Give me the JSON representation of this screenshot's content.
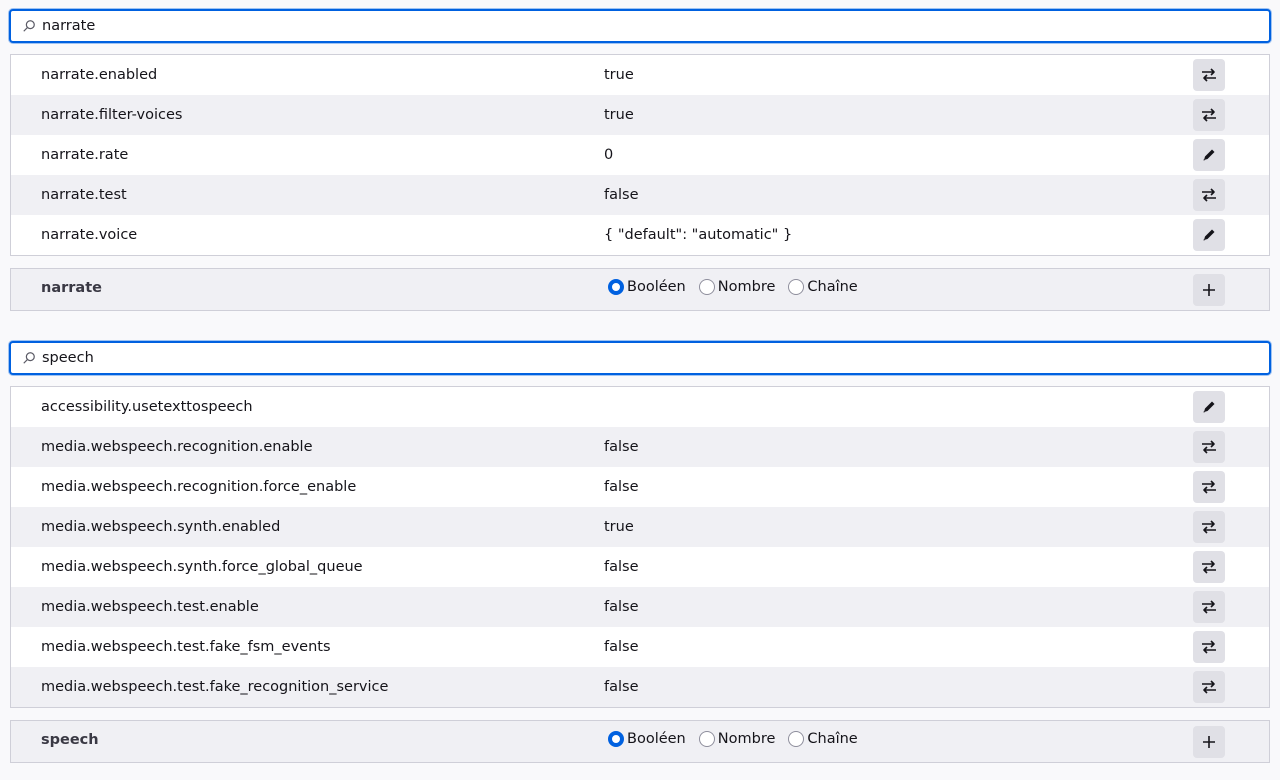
{
  "narrate_section": {
    "search_value": "narrate",
    "rows": [
      {
        "name": "narrate.enabled",
        "value": "true",
        "action": "toggle"
      },
      {
        "name": "narrate.filter-voices",
        "value": "true",
        "action": "toggle"
      },
      {
        "name": "narrate.rate",
        "value": "0",
        "action": "edit"
      },
      {
        "name": "narrate.test",
        "value": "false",
        "action": "toggle"
      },
      {
        "name": "narrate.voice",
        "value": "{ \"default\": \"automatic\" }",
        "action": "edit"
      }
    ],
    "add": {
      "name": "narrate",
      "types": [
        "Booléen",
        "Nombre",
        "Chaîne"
      ],
      "selected": "Booléen"
    }
  },
  "speech_section": {
    "search_value": "speech",
    "rows": [
      {
        "name": "accessibility.usetexttospeech",
        "value": "",
        "action": "edit"
      },
      {
        "name": "media.webspeech.recognition.enable",
        "value": "false",
        "action": "toggle"
      },
      {
        "name": "media.webspeech.recognition.force_enable",
        "value": "false",
        "action": "toggle"
      },
      {
        "name": "media.webspeech.synth.enabled",
        "value": "true",
        "action": "toggle"
      },
      {
        "name": "media.webspeech.synth.force_global_queue",
        "value": "false",
        "action": "toggle"
      },
      {
        "name": "media.webspeech.test.enable",
        "value": "false",
        "action": "toggle"
      },
      {
        "name": "media.webspeech.test.fake_fsm_events",
        "value": "false",
        "action": "toggle"
      },
      {
        "name": "media.webspeech.test.fake_recognition_service",
        "value": "false",
        "action": "toggle"
      }
    ],
    "add": {
      "name": "speech",
      "types": [
        "Booléen",
        "Nombre",
        "Chaîne"
      ],
      "selected": "Booléen"
    }
  },
  "icons": {
    "search": "search-icon",
    "toggle": "toggle-arrows-icon",
    "edit": "pencil-icon",
    "add": "plus-icon"
  },
  "colors": {
    "accent": "#0061e0",
    "button_bg": "#e0e0e6",
    "alt_row": "#f0f0f4"
  }
}
